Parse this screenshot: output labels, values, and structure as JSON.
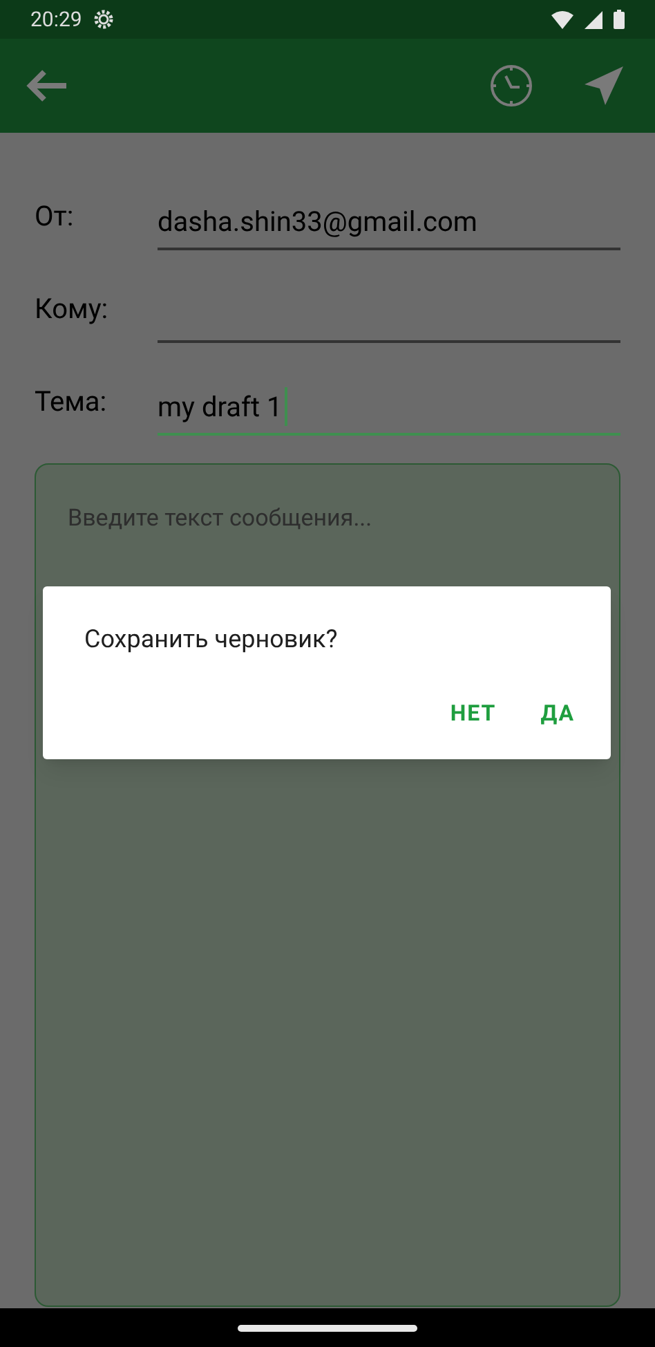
{
  "status_bar": {
    "time": "20:29"
  },
  "fields": [
    {
      "label": "От:",
      "value": "dasha.shin33@gmail.com",
      "focused": false
    },
    {
      "label": "Кому:",
      "focused": false
    },
    {
      "label": "Тема:",
      "value": "my draft 1",
      "focused": true
    }
  ],
  "message": {
    "placeholder": "Введите текст сообщения..."
  },
  "dialog": {
    "title": "Сохранить черновик?",
    "buttons": [
      "НЕТ",
      "ДА"
    ]
  }
}
